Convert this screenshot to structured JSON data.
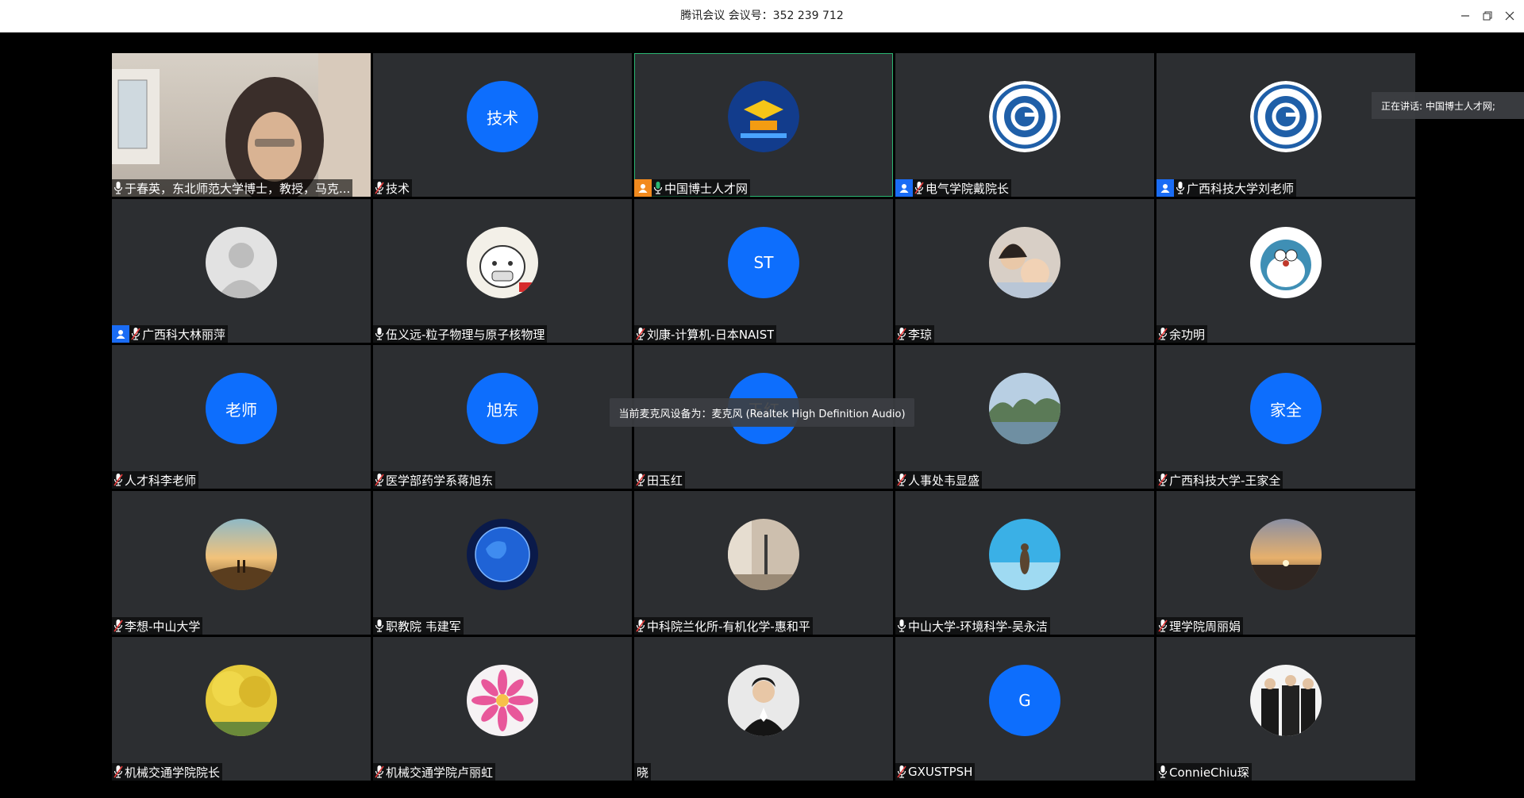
{
  "window": {
    "title": "腾讯会议 会议号：352 239 712",
    "controls": [
      "minimize",
      "restore",
      "close"
    ]
  },
  "speaking_indicator": "正在讲话: 中国博士人才网;",
  "toast": "当前麦克风设备为：麦克风 (Realtek High Definition Audio)",
  "participants": [
    {
      "name": "于春英，东北师范大学博士，教授，马克...",
      "avatar": "video",
      "mic": "on",
      "badge": ""
    },
    {
      "name": "技术",
      "avatar": "text",
      "avatar_text": "技术",
      "mic": "muted",
      "badge": ""
    },
    {
      "name": "中国博士人才网",
      "avatar": "logo-boshi",
      "mic": "speaking",
      "badge": "orange",
      "active": true
    },
    {
      "name": "电气学院戴院长",
      "avatar": "logo-university",
      "mic": "muted",
      "badge": "blue"
    },
    {
      "name": "广西科技大学刘老师",
      "avatar": "logo-university",
      "mic": "on",
      "badge": "blue"
    },
    {
      "name": "广西科大林丽萍",
      "avatar": "default",
      "mic": "muted",
      "badge": "blue"
    },
    {
      "name": "伍义远-粒子物理与原子核物理",
      "avatar": "photo-cartoon",
      "mic": "on",
      "badge": ""
    },
    {
      "name": "刘康-计算机-日本NAIST",
      "avatar": "text",
      "avatar_text": "ST",
      "mic": "muted",
      "badge": ""
    },
    {
      "name": "李琼",
      "avatar": "photo-people",
      "mic": "muted",
      "badge": ""
    },
    {
      "name": "余功明",
      "avatar": "photo-doraemon",
      "mic": "muted",
      "badge": ""
    },
    {
      "name": "人才科李老师",
      "avatar": "text",
      "avatar_text": "老师",
      "mic": "muted",
      "badge": ""
    },
    {
      "name": "医学部药学系蒋旭东",
      "avatar": "text",
      "avatar_text": "旭东",
      "mic": "muted",
      "badge": ""
    },
    {
      "name": "田玉红",
      "avatar": "text",
      "avatar_text": "玉红",
      "mic": "muted",
      "badge": ""
    },
    {
      "name": "人事处韦显盛",
      "avatar": "photo-landscape",
      "mic": "muted",
      "badge": ""
    },
    {
      "name": "广西科技大学-王家全",
      "avatar": "text",
      "avatar_text": "家全",
      "mic": "muted",
      "badge": ""
    },
    {
      "name": "李想-中山大学",
      "avatar": "photo-sunset-people",
      "mic": "muted",
      "badge": ""
    },
    {
      "name": "职教院 韦建军",
      "avatar": "photo-globe",
      "mic": "on",
      "badge": ""
    },
    {
      "name": "中科院兰化所-有机化学-惠和平",
      "avatar": "photo-room",
      "mic": "muted",
      "badge": ""
    },
    {
      "name": "中山大学-环境科学-吴永洁",
      "avatar": "photo-sea",
      "mic": "on",
      "badge": ""
    },
    {
      "name": "理学院周丽娟",
      "avatar": "photo-sunset",
      "mic": "muted",
      "badge": ""
    },
    {
      "name": "机械交通学院院长",
      "avatar": "photo-ginkgo",
      "mic": "muted",
      "badge": ""
    },
    {
      "name": "机械交通学院卢丽虹",
      "avatar": "photo-flower",
      "mic": "muted",
      "badge": ""
    },
    {
      "name": "晓",
      "avatar": "photo-man",
      "mic": "none",
      "badge": ""
    },
    {
      "name": "GXUSTPSH",
      "avatar": "text",
      "avatar_text": "G",
      "mic": "muted",
      "badge": ""
    },
    {
      "name": "ConnieChiu琛",
      "avatar": "photo-graduation",
      "mic": "on",
      "badge": ""
    }
  ],
  "colors": {
    "tile_bg": "#2c2e31",
    "avatar_blue": "#0d6efd",
    "badge_blue": "#1a6cf5",
    "badge_orange": "#f28a1e",
    "speaking_green": "#2bb673",
    "muted_red": "#e23b3b"
  }
}
